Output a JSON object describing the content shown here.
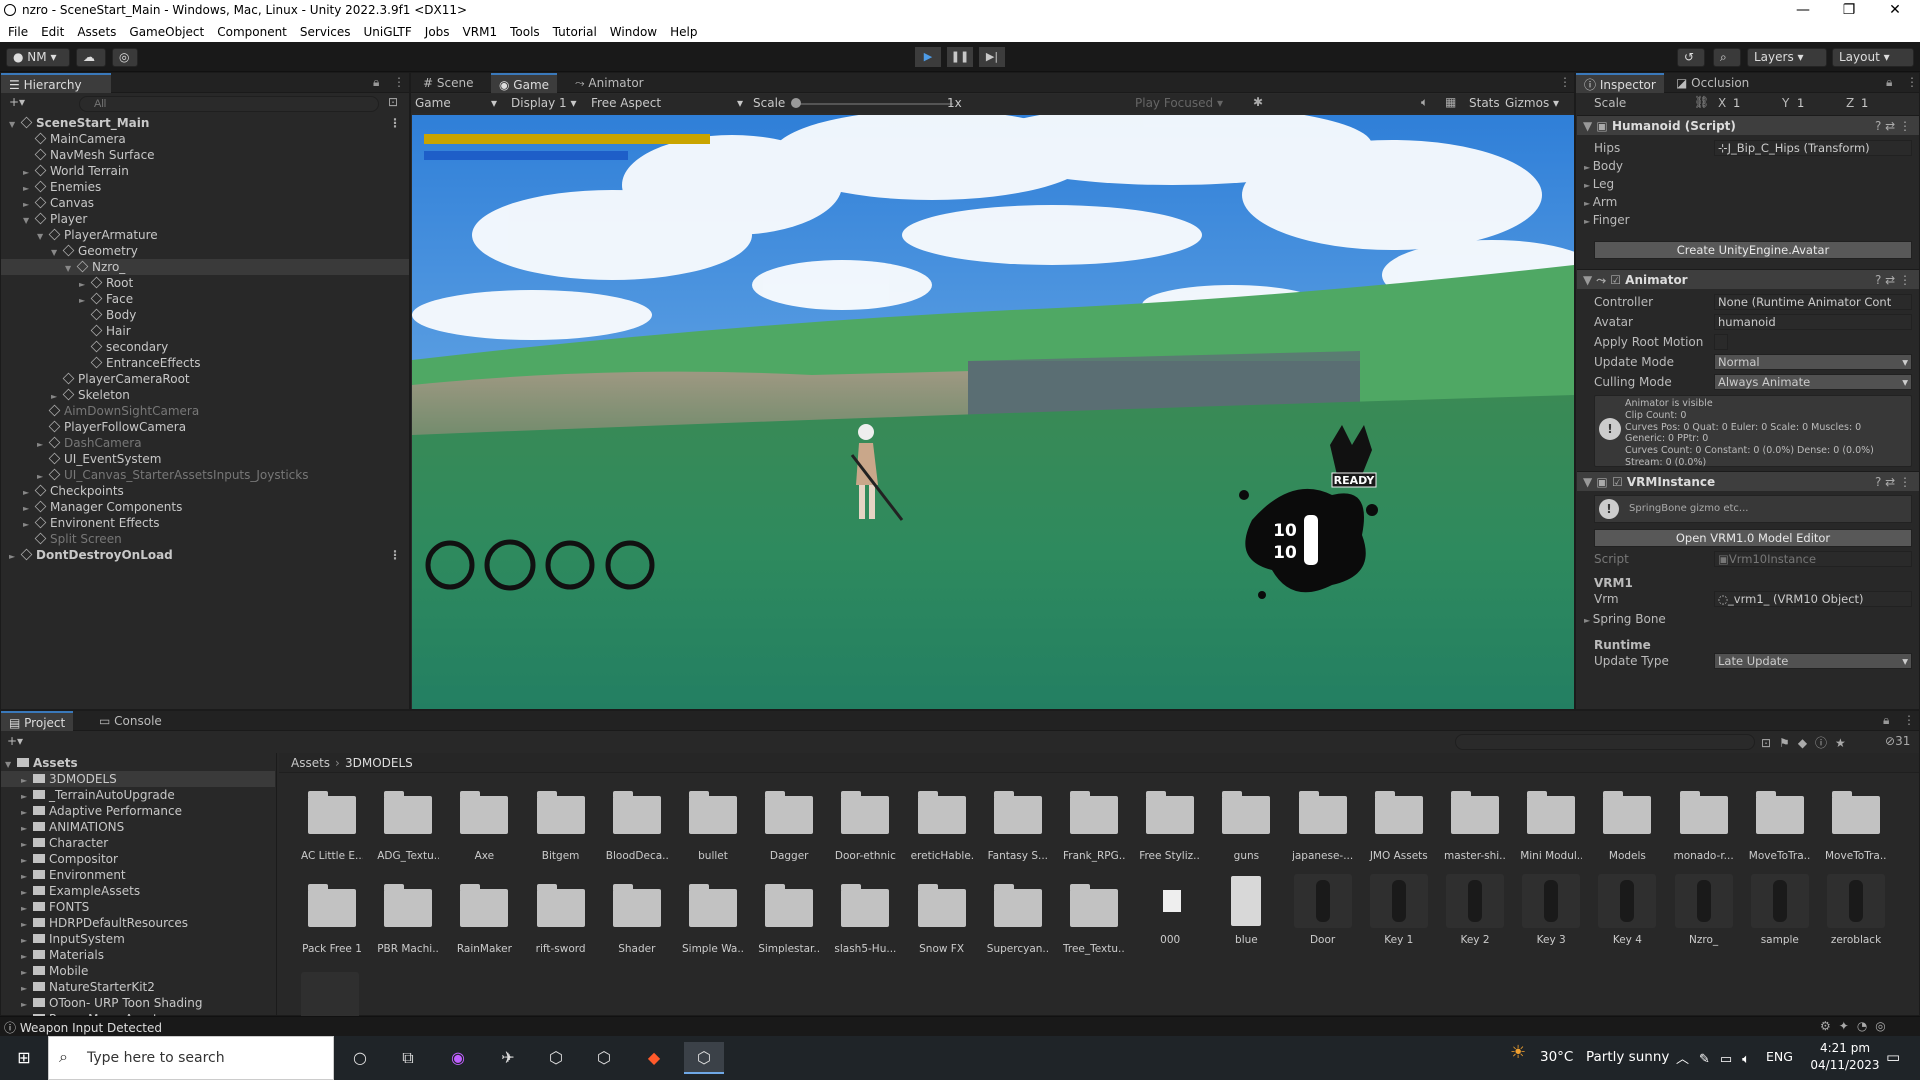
{
  "window": {
    "title": "nzro - SceneStart_Main - Windows, Mac, Linux - Unity 2022.3.9f1 <DX11>",
    "controls": [
      "—",
      "❐",
      "✕"
    ]
  },
  "menu": [
    "File",
    "Edit",
    "Assets",
    "GameObject",
    "Component",
    "Services",
    "UniGLTF",
    "Jobs",
    "VRM1",
    "Tools",
    "Tutorial",
    "Window",
    "Help"
  ],
  "toolbar": {
    "account": "NM",
    "layers": "Layers",
    "layout": "Layout"
  },
  "hierarchy": {
    "tab": "Hierarchy",
    "search_placeholder": "All",
    "items": [
      {
        "label": "SceneStart_Main",
        "depth": 0,
        "arrow": "▼",
        "dim": false,
        "scene": true
      },
      {
        "label": "MainCamera",
        "depth": 1,
        "arrow": "",
        "dim": false
      },
      {
        "label": "NavMesh Surface",
        "depth": 1,
        "arrow": "",
        "dim": false
      },
      {
        "label": "World Terrain",
        "depth": 1,
        "arrow": "►",
        "dim": false
      },
      {
        "label": "Enemies",
        "depth": 1,
        "arrow": "►",
        "dim": false
      },
      {
        "label": "Canvas",
        "depth": 1,
        "arrow": "►",
        "dim": false
      },
      {
        "label": "Player",
        "depth": 1,
        "arrow": "▼",
        "dim": false
      },
      {
        "label": "PlayerArmature",
        "depth": 2,
        "arrow": "▼",
        "dim": false
      },
      {
        "label": "Geometry",
        "depth": 3,
        "arrow": "▼",
        "dim": false
      },
      {
        "label": "Nzro_",
        "depth": 4,
        "arrow": "▼",
        "dim": false,
        "selected": true
      },
      {
        "label": "Root",
        "depth": 5,
        "arrow": "►",
        "dim": false
      },
      {
        "label": "Face",
        "depth": 5,
        "arrow": "►",
        "dim": false
      },
      {
        "label": "Body",
        "depth": 5,
        "arrow": "",
        "dim": false
      },
      {
        "label": "Hair",
        "depth": 5,
        "arrow": "",
        "dim": false
      },
      {
        "label": "secondary",
        "depth": 5,
        "arrow": "",
        "dim": false
      },
      {
        "label": "EntranceEffects",
        "depth": 5,
        "arrow": "",
        "dim": false
      },
      {
        "label": "PlayerCameraRoot",
        "depth": 3,
        "arrow": "",
        "dim": false
      },
      {
        "label": "Skeleton",
        "depth": 3,
        "arrow": "►",
        "dim": false
      },
      {
        "label": "AimDownSightCamera",
        "depth": 2,
        "arrow": "",
        "dim": true
      },
      {
        "label": "PlayerFollowCamera",
        "depth": 2,
        "arrow": "",
        "dim": false
      },
      {
        "label": "DashCamera",
        "depth": 2,
        "arrow": "►",
        "dim": true
      },
      {
        "label": "UI_EventSystem",
        "depth": 2,
        "arrow": "",
        "dim": false
      },
      {
        "label": "UI_Canvas_StarterAssetsInputs_Joysticks",
        "depth": 2,
        "arrow": "►",
        "dim": true
      },
      {
        "label": "Checkpoints",
        "depth": 1,
        "arrow": "►",
        "dim": false
      },
      {
        "label": "Manager Components",
        "depth": 1,
        "arrow": "►",
        "dim": false
      },
      {
        "label": "Environent Effects",
        "depth": 1,
        "arrow": "►",
        "dim": false
      },
      {
        "label": "Split Screen",
        "depth": 1,
        "arrow": "",
        "dim": true
      },
      {
        "label": "DontDestroyOnLoad",
        "depth": 0,
        "arrow": "►",
        "dim": false,
        "scene": true
      }
    ]
  },
  "game": {
    "tabs": [
      "Scene",
      "Game",
      "Animator"
    ],
    "mode": "Game",
    "display": "Display 1",
    "aspect": "Free Aspect",
    "scale_label": "Scale",
    "scale_value": "1x",
    "play_focused": "Play Focused",
    "stats": "Stats",
    "gizmos": "Gizmos",
    "health_fill": 0.94,
    "mana_fill": 0.68,
    "ready": "READY",
    "ammo_top": "10",
    "ammo_bottom": "10"
  },
  "inspector": {
    "tabs": [
      "Inspector",
      "Occlusion"
    ],
    "scale_label": "Scale",
    "scale_x": "1",
    "scale_y": "1",
    "scale_z": "1",
    "humanoid": {
      "title": "Humanoid (Script)",
      "hips_label": "Hips",
      "hips_value": "J_Bip_C_Hips (Transform)",
      "groups": [
        "Body",
        "Leg",
        "Arm",
        "Finger"
      ],
      "button": "Create UnityEngine.Avatar"
    },
    "animator": {
      "title": "Animator",
      "fields": [
        {
          "label": "Controller",
          "value": "None (Runtime Animator Cont"
        },
        {
          "label": "Avatar",
          "value": "humanoid"
        },
        {
          "label": "Apply Root Motion",
          "value": ""
        },
        {
          "label": "Update Mode",
          "value": "Normal"
        },
        {
          "label": "Culling Mode",
          "value": "Always Animate"
        }
      ],
      "info": [
        "Animator is visible",
        "Clip Count: 0",
        "Curves Pos: 0 Quat: 0 Euler: 0 Scale: 0 Muscles: 0",
        "Generic: 0 PPtr: 0",
        "Curves Count: 0 Constant: 0 (0.0%) Dense: 0 (0.0%)",
        "Stream: 0 (0.0%)"
      ]
    },
    "vrm": {
      "title": "VRMInstance",
      "help": "SpringBone gizmo etc...",
      "button": "Open VRM1.0 Model Editor",
      "script_label": "Script",
      "script_value": "Vrm10Instance",
      "section_vrm1": "VRM1",
      "vrm_label": "Vrm",
      "vrm_value": "_vrm1_ (VRM10 Object)",
      "spring_bone": "Spring Bone",
      "section_runtime": "Runtime",
      "update_type_label": "Update Type",
      "update_type_value": "Late Update"
    }
  },
  "project": {
    "tabs": [
      "Project",
      "Console"
    ],
    "hidden_count": "31",
    "breadcrumb": [
      "Assets",
      "3DMODELS"
    ],
    "tree": [
      "Assets",
      "3DMODELS",
      "_TerrainAutoUpgrade",
      "Adaptive Performance",
      "ANIMATIONS",
      "Character",
      "Compositor",
      "Environment",
      "ExampleAssets",
      "FONTS",
      "HDRPDefaultResources",
      "InputSystem",
      "Materials",
      "Mobile",
      "NatureStarterKit2",
      "OToon- URP Toon Shading",
      "Pause Menu Assets"
    ],
    "row1": [
      "AC Little E...",
      "ADG_Textu...",
      "Axe",
      "Bitgem",
      "BloodDeca...",
      "bullet",
      "Dagger",
      "Door-ethnic",
      "ereticHable...",
      "Fantasy S...",
      "Frank_RPG...",
      "Free Styliz...",
      "guns",
      "japanese-...",
      "JMO Assets",
      "master-shi...",
      "Mini Modul...",
      "Models",
      "monado-r...",
      "MoveToTra...",
      "MoveToTra..."
    ],
    "row2_folders": [
      "Pack Free 1",
      "PBR Machi...",
      "RainMaker",
      "rift-sword",
      "Shader",
      "Simple Wa...",
      "Simplestar...",
      "slash5-Hu...",
      "Snow FX",
      "Supercyan...",
      "Tree_Textu..."
    ],
    "row2_assets": [
      "000",
      "blue",
      "Door",
      "Key 1",
      "Key 2",
      "Key 3",
      "Key 4",
      "Nzro_",
      "sample",
      "zeroblack"
    ]
  },
  "status": "Weapon Input Detected",
  "taskbar": {
    "search_placeholder": "Type here to search",
    "weather_temp": "30°C",
    "weather_desc": "Partly sunny",
    "lang": "ENG",
    "time": "4:21 pm",
    "date": "04/11/2023"
  }
}
